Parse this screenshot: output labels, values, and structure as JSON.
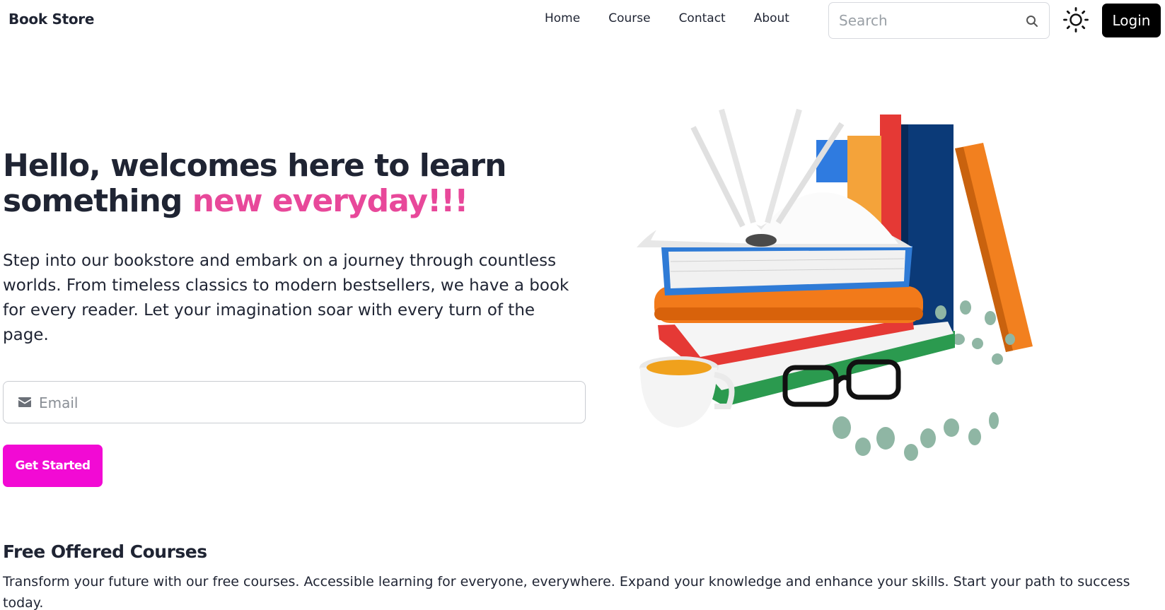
{
  "nav": {
    "brand": "Book Store",
    "links": [
      "Home",
      "Course",
      "Contact",
      "About"
    ],
    "search_placeholder": "Search",
    "login_label": "Login"
  },
  "hero": {
    "title_part1": "Hello, welcomes here to learn something",
    "title_highlight": "new everyday!!!",
    "description": "Step into our bookstore and embark on a journey through countless worlds. From timeless classics to modern bestsellers, we have a book for every reader. Let your imagination soar with every turn of the page.",
    "email_placeholder": "Email",
    "cta_label": "Get Started"
  },
  "courses": {
    "title": "Free Offered Courses",
    "description": "Transform your future with our free courses. Accessible learning for everyone, everywhere. Expand your knowledge and enhance your skills. Start your path to success today."
  },
  "colors": {
    "accent_pink": "#e8489a",
    "cta_magenta": "#f20ad4",
    "login_black": "#000000",
    "text_dark": "#1f2433"
  },
  "icons": {
    "search": "search-icon",
    "theme": "sun-icon",
    "email": "envelope-icon"
  }
}
